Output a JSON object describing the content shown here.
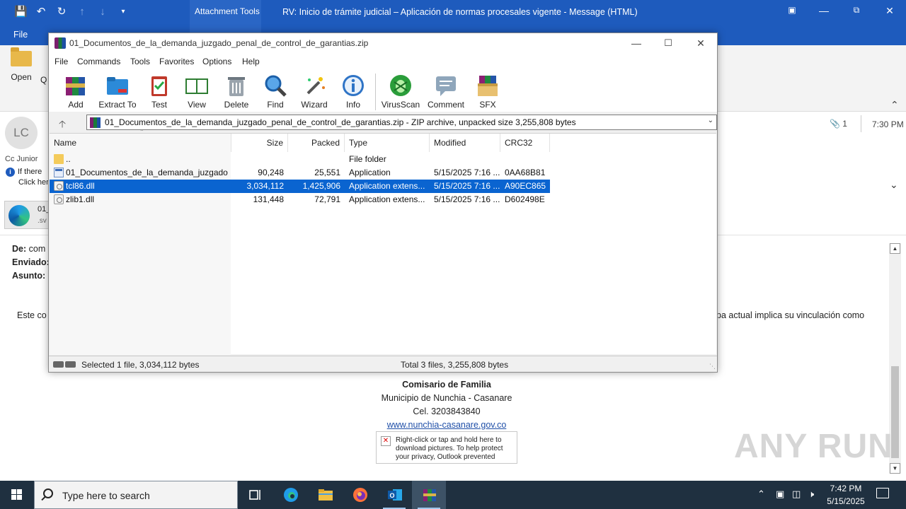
{
  "outlook": {
    "attachment_tools": "Attachment Tools",
    "title": "RV: Inicio de trámite judicial – Aplicación de normas procesales vigente  -  Message (HTML)",
    "file_tab": "File",
    "open_label": "Open",
    "q_fragment": "Q",
    "p_fragment": "P",
    "avatar_initials": "LC",
    "cc_label": "Cc   Junior",
    "info_line1": "If there",
    "info_line2": "Click her",
    "attachment_count": "1",
    "received_time": "7:30 PM",
    "attachment_card_name": "01_",
    "attachment_card_ext": ".sv",
    "from_label": "De:",
    "from_value": "com",
    "sent_label": "Enviado:",
    "subject_label": "Asunto:",
    "body_left": "Este co",
    "body_right": "pa actual implica su vinculación como",
    "signature": {
      "role": "Comisario de Familia",
      "municipality": "Municipio de Nunchia - Casanare",
      "phone": "Cel. 3203843840",
      "website": "www.nunchia-casanare.gov.co"
    },
    "image_placeholder_text": "Right-click or tap and hold here to download pictures. To help protect your privacy, Outlook prevented",
    "watermark": "ANY RUN"
  },
  "winrar": {
    "title": "01_Documentos_de_la_demanda_juzgado_penal_de_control_de_garantias.zip",
    "menu": [
      "File",
      "Commands",
      "Tools",
      "Favorites",
      "Options",
      "Help"
    ],
    "toolbar": [
      "Add",
      "Extract To",
      "Test",
      "View",
      "Delete",
      "Find",
      "Wizard",
      "Info",
      "VirusScan",
      "Comment",
      "SFX"
    ],
    "address": "01_Documentos_de_la_demanda_juzgado_penal_de_control_de_garantias.zip - ZIP archive, unpacked size 3,255,808 bytes",
    "columns": [
      "Name",
      "Size",
      "Packed",
      "Type",
      "Modified",
      "CRC32"
    ],
    "rows": [
      {
        "name": "..",
        "size": "",
        "packed": "",
        "type": "File folder",
        "modified": "",
        "crc": ""
      },
      {
        "name": "01_Documentos_de_la_demanda_juzgado...",
        "size": "90,248",
        "packed": "25,551",
        "type": "Application",
        "modified": "5/15/2025 7:16 ...",
        "crc": "0AA68B81"
      },
      {
        "name": "tcl86.dll",
        "size": "3,034,112",
        "packed": "1,425,906",
        "type": "Application extens...",
        "modified": "5/15/2025 7:16 ...",
        "crc": "A90EC865"
      },
      {
        "name": "zlib1.dll",
        "size": "131,448",
        "packed": "72,791",
        "type": "Application extens...",
        "modified": "5/15/2025 7:16 ...",
        "crc": "D602498E"
      }
    ],
    "status_left": "Selected 1 file, 3,034,112 bytes",
    "status_right": "Total 3 files, 3,255,808 bytes"
  },
  "taskbar": {
    "search_placeholder": "Type here to search",
    "time": "7:42 PM",
    "date": "5/15/2025"
  }
}
